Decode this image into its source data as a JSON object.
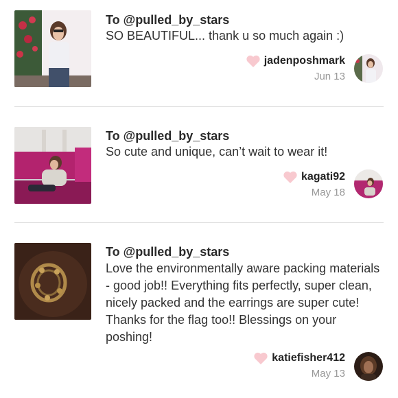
{
  "notes": [
    {
      "to": "To @pulled_by_stars",
      "message": "SO BEAUTIFUL... thank u so much again :)",
      "username": "jadenposhmark",
      "date": "Jun 13",
      "thumb_icon": "photo-girl-roses",
      "avatar_icon": "avatar-photo"
    },
    {
      "to": "To @pulled_by_stars",
      "message": "So cute and unique, can’t wait to wear it!",
      "username": "kagati92",
      "date": "May 18",
      "thumb_icon": "photo-pink-chairs",
      "avatar_icon": "avatar-photo"
    },
    {
      "to": "To @pulled_by_stars",
      "message": "Love the environmentally aware packing materials - good job!! Everything fits perfectly, super clean, nicely packed and the earrings are super cute! Thanks for the flag too!! Blessings on your poshing!",
      "username": "katiefisher412",
      "date": "May 13",
      "thumb_icon": "photo-gold-earring",
      "avatar_icon": "avatar-photo"
    }
  ],
  "colors": {
    "heart": "#f8c9cf",
    "divider": "#dddddd",
    "date": "#999999",
    "text": "#333333"
  }
}
